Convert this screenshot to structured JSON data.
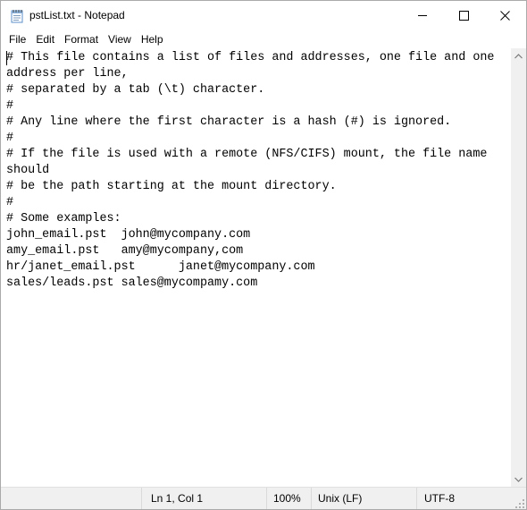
{
  "window": {
    "title": "pstList.txt - Notepad"
  },
  "icons": {
    "app": "notepad-icon",
    "minimize": "minimize-icon",
    "maximize": "maximize-icon",
    "close": "close-icon",
    "scroll_up": "chevron-up-icon",
    "scroll_down": "chevron-down-icon",
    "grip": "resize-grip-icon"
  },
  "menu": {
    "items": [
      {
        "label": "File"
      },
      {
        "label": "Edit"
      },
      {
        "label": "Format"
      },
      {
        "label": "View"
      },
      {
        "label": "Help"
      }
    ]
  },
  "editor": {
    "content": "# This file contains a list of files and addresses, one file and one\naddress per line,\n# separated by a tab (\\t) character.\n#\n# Any line where the first character is a hash (#) is ignored.\n#\n# If the file is used with a remote (NFS/CIFS) mount, the file name\nshould\n# be the path starting at the mount directory.\n#\n# Some examples:\njohn_email.pst  john@mycompany.com\namy_email.pst   amy@mycompany,com\nhr/janet_email.pst      janet@mycompany.com\nsales/leads.pst sales@mycompamy.com"
  },
  "status": {
    "position": "Ln 1, Col 1",
    "zoom": "100%",
    "line_ending": "Unix (LF)",
    "encoding": "UTF-8"
  }
}
